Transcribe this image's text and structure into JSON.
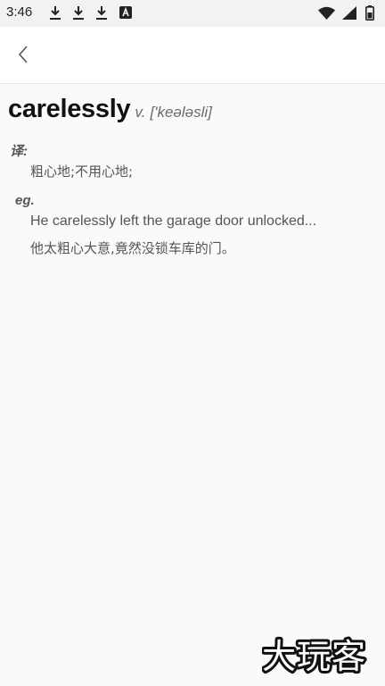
{
  "status_bar": {
    "time": "3:46",
    "notification_icons": [
      "download-icon",
      "download-icon",
      "download-icon",
      "font-a-icon"
    ],
    "right_icons": [
      "wifi-icon",
      "signal-icon",
      "battery-icon"
    ]
  },
  "header": {
    "back_icon": "chevron-left-icon"
  },
  "entry": {
    "word": "carelessly",
    "part_of_speech": "v.",
    "phonetic": "['keələsli]",
    "translation_label": "译:",
    "translation": "粗心地;不用心地;",
    "example_label": "eg.",
    "example_en": "He carelessly left the garage door unlocked...",
    "example_zh": "他太粗心大意,竟然没锁车库的门。"
  },
  "watermark": {
    "text": "大玩客"
  },
  "colors": {
    "background": "#fafafa",
    "header": "#ffffff",
    "headword": "#111111",
    "secondary_text": "#555555",
    "phonetic": "#6b6b6b"
  }
}
